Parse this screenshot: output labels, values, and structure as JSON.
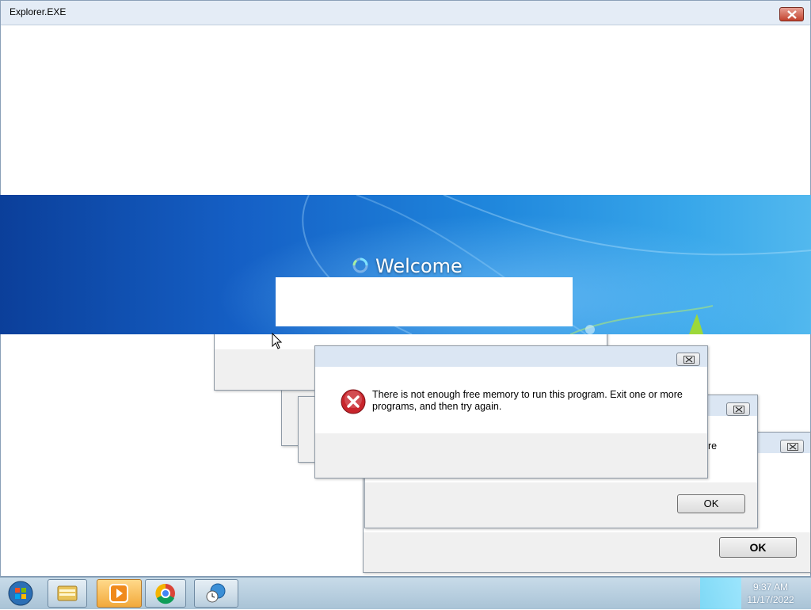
{
  "main_window": {
    "title": "Explorer.EXE"
  },
  "welcome": {
    "label": "Welcome"
  },
  "dialogs": {
    "front": {
      "message": "There is not enough free memory to run this program. Exit one or more programs, and then try again."
    },
    "middle": {
      "partial_text": "ore",
      "ok_label": "OK"
    },
    "back": {
      "partial_text": "r",
      "ok_label": "OK"
    }
  },
  "taskbar": {
    "buttons": [
      "start-orb-icon",
      "file-explorer-icon",
      "media-player-icon",
      "chrome-icon",
      "network-clock-icon"
    ],
    "clock": {
      "time": "9:37 AM",
      "date": "11/17/2022"
    }
  },
  "colors": {
    "accent": "#1f86dc",
    "error_red": "#c8252c",
    "taskbar": "#b8d0e0"
  }
}
